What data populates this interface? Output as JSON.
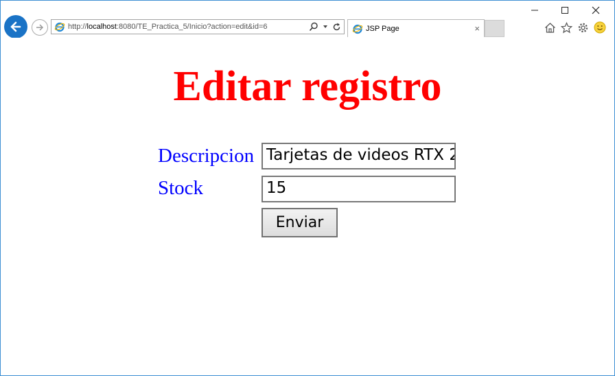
{
  "browser": {
    "address": {
      "prefix": "http://",
      "host": "localhost",
      "rest": ":8080/TE_Practica_5/Inicio?action=edit&id=6"
    },
    "tab": {
      "title": "JSP Page",
      "close": "×"
    },
    "window_controls": {
      "minimize": "—",
      "maximize": "☐",
      "close": "✕"
    }
  },
  "page": {
    "title": "Editar registro",
    "form": {
      "descripcion_label": "Descripcion",
      "descripcion_value": "Tarjetas de videos RTX 2",
      "stock_label": "Stock",
      "stock_value": "15",
      "submit_label": "Enviar"
    }
  },
  "colors": {
    "title": "#ff0000",
    "labels": "#0000ff",
    "back_button": "#1a73c6"
  },
  "icons": [
    "back-icon",
    "forward-icon",
    "ie-logo-icon",
    "search-icon",
    "refresh-icon",
    "home-icon",
    "favorites-star-icon",
    "settings-gear-icon",
    "smiley-feedback-icon"
  ]
}
